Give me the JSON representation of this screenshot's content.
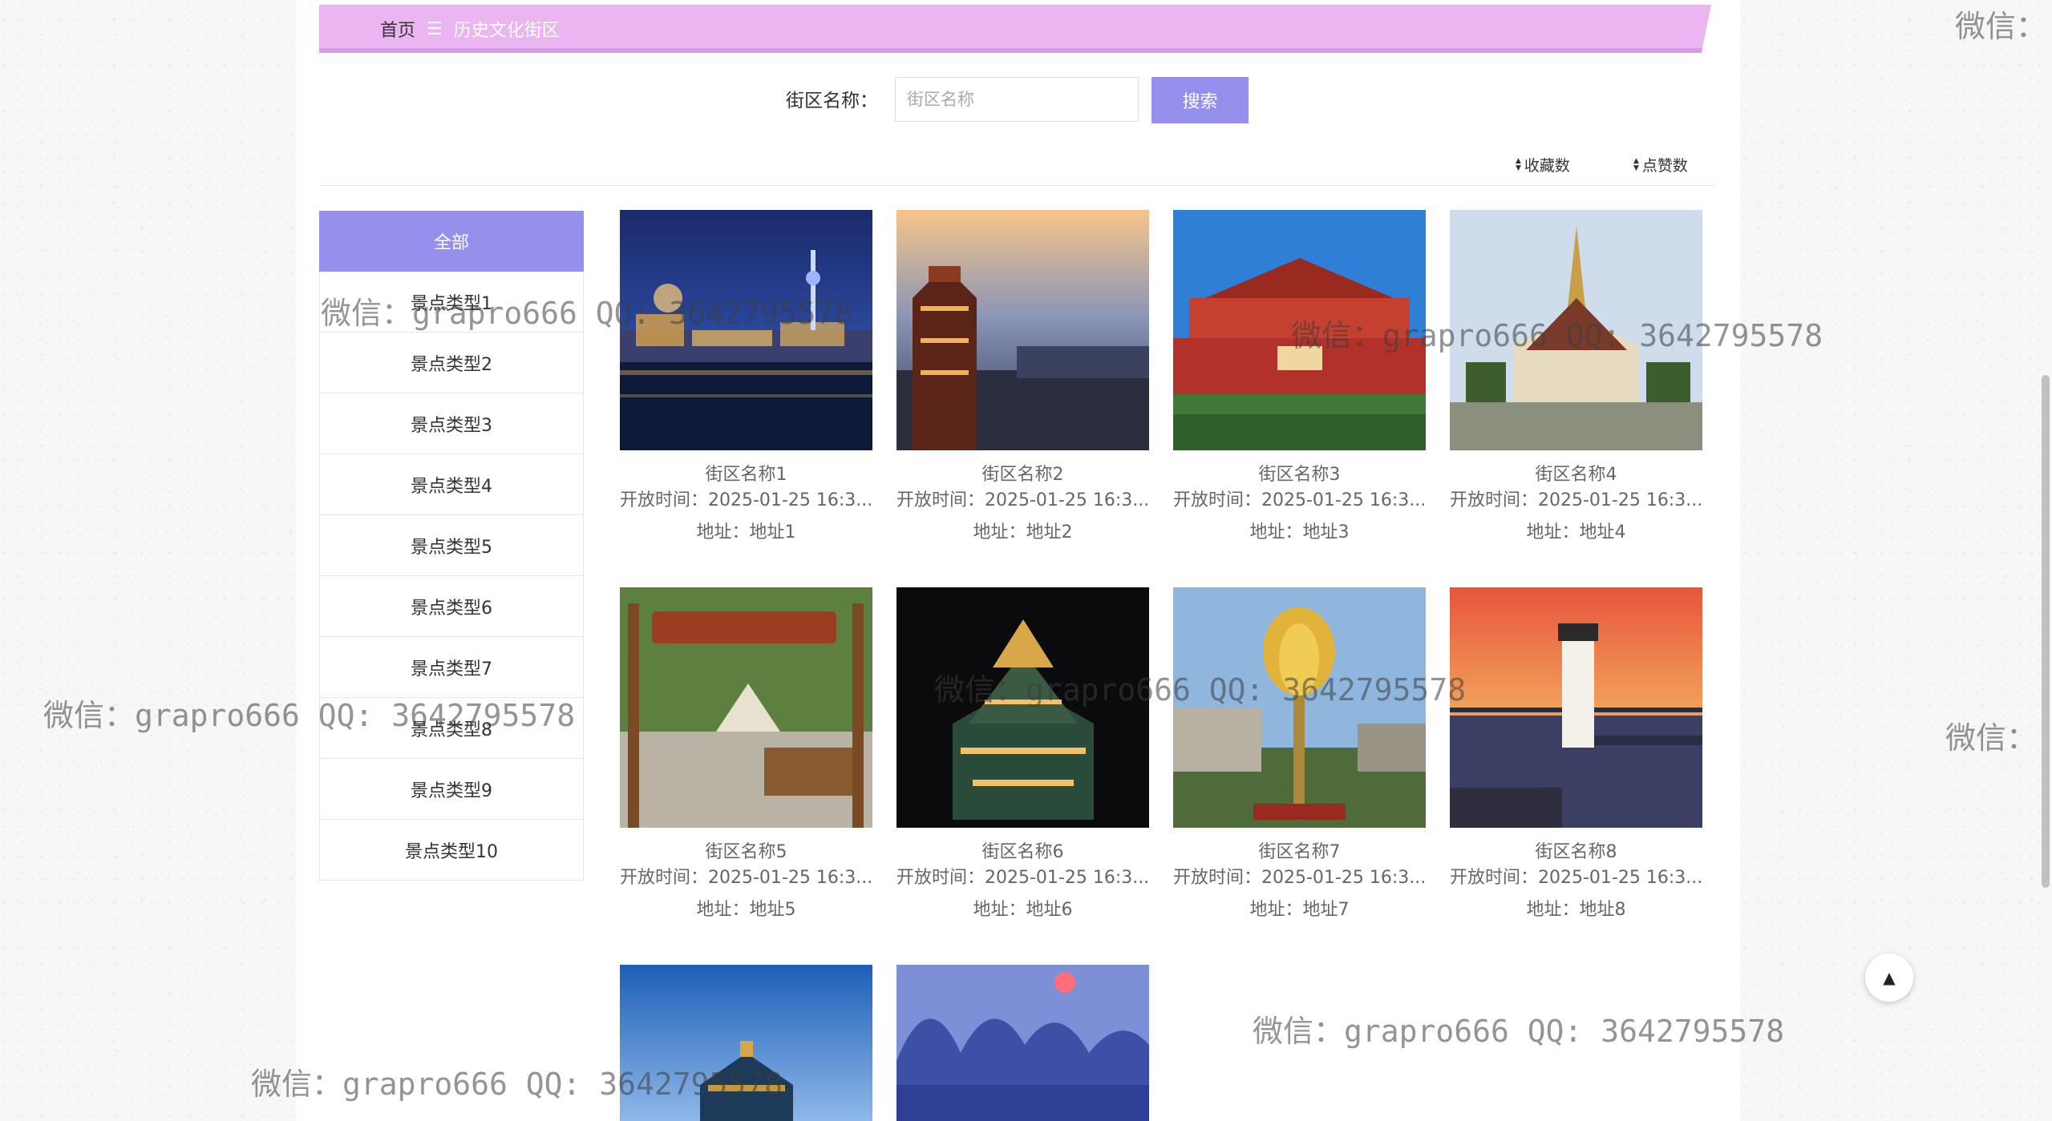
{
  "breadcrumb": {
    "home": "首页",
    "separator": "☰",
    "current": "历史文化街区"
  },
  "search": {
    "label": "街区名称：",
    "placeholder": "街区名称",
    "button": "搜索"
  },
  "sort": {
    "favorites": "收藏数",
    "likes": "点赞数"
  },
  "sidebar": {
    "items": [
      {
        "label": "全部",
        "active": true
      },
      {
        "label": "景点类型1"
      },
      {
        "label": "景点类型2"
      },
      {
        "label": "景点类型3"
      },
      {
        "label": "景点类型4"
      },
      {
        "label": "景点类型5"
      },
      {
        "label": "景点类型6"
      },
      {
        "label": "景点类型7"
      },
      {
        "label": "景点类型8"
      },
      {
        "label": "景点类型9"
      },
      {
        "label": "景点类型10"
      }
    ]
  },
  "cards": [
    {
      "name": "街区名称1",
      "time": "开放时间：2025-01-25 16:3...",
      "address": "地址：地址1"
    },
    {
      "name": "街区名称2",
      "time": "开放时间：2025-01-25 16:3...",
      "address": "地址：地址2"
    },
    {
      "name": "街区名称3",
      "time": "开放时间：2025-01-25 16:3...",
      "address": "地址：地址3"
    },
    {
      "name": "街区名称4",
      "time": "开放时间：2025-01-25 16:3...",
      "address": "地址：地址4"
    },
    {
      "name": "街区名称5",
      "time": "开放时间：2025-01-25 16:3...",
      "address": "地址：地址5"
    },
    {
      "name": "街区名称6",
      "time": "开放时间：2025-01-25 16:3...",
      "address": "地址：地址6"
    },
    {
      "name": "街区名称7",
      "time": "开放时间：2025-01-25 16:3...",
      "address": "地址：地址7"
    },
    {
      "name": "街区名称8",
      "time": "开放时间：2025-01-25 16:3...",
      "address": "地址：地址8"
    },
    {
      "name": "",
      "time": "",
      "address": ""
    },
    {
      "name": "",
      "time": "",
      "address": ""
    }
  ],
  "watermarks": {
    "full": "微信：grapro666 QQ: 3642795578",
    "partial": "微信："
  },
  "colors": {
    "accent": "#9590ee",
    "breadcrumb": "#ebb5f2"
  }
}
